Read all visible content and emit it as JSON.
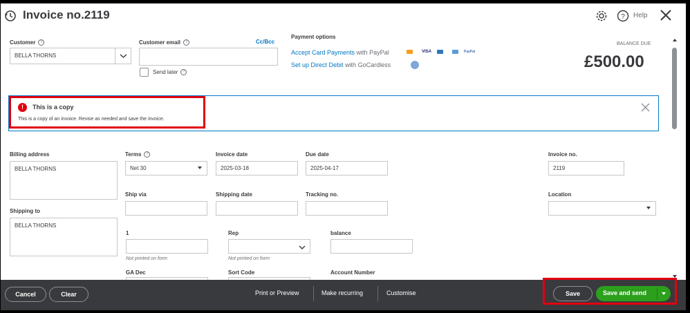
{
  "header": {
    "title": "Invoice no.2119",
    "help_label": "Help"
  },
  "customer": {
    "label": "Customer",
    "value": "BELLA THORNS",
    "email_label": "Customer email",
    "email_value": "",
    "ccbcc_label": "Cc/Bcc",
    "send_later_label": "Send later"
  },
  "payment": {
    "label": "Payment options",
    "card_link": "Accept Card Payments",
    "card_suffix": "with PayPal",
    "debit_link": "Set up Direct Debit",
    "debit_suffix": "with GoCardless",
    "card_brands": [
      "VISA",
      "PayPal"
    ]
  },
  "balance": {
    "label": "BALANCE DUE",
    "amount": "£500.00"
  },
  "alert": {
    "title": "This is a copy",
    "message": "This is a copy of an invoice. Revise as needed and save the invoice."
  },
  "billing": {
    "label": "Billing address",
    "value": "BELLA THORNS",
    "shipping_label": "Shipping to",
    "shipping_value": "BELLA THORNS"
  },
  "terms": {
    "label": "Terms",
    "value": "Net 30"
  },
  "invoice_date": {
    "label": "Invoice date",
    "value": "2025-03-18"
  },
  "due_date": {
    "label": "Due date",
    "value": "2025-04-17"
  },
  "invoice_no": {
    "label": "Invoice no.",
    "value": "2119"
  },
  "ship_via": {
    "label": "Ship via",
    "value": ""
  },
  "shipping_date": {
    "label": "Shipping date",
    "value": ""
  },
  "tracking_no": {
    "label": "Tracking no.",
    "value": ""
  },
  "location": {
    "label": "Location",
    "value": ""
  },
  "custom1": {
    "label": "1",
    "value": "",
    "note": "Not printed on form"
  },
  "rep": {
    "label": "Rep",
    "value": "",
    "note": "Not printed on form"
  },
  "balance_field": {
    "label": "balance",
    "value": ""
  },
  "ga_dec": {
    "label": "GA Dec"
  },
  "sort_code": {
    "label": "Sort Code"
  },
  "account_number": {
    "label": "Account Number"
  },
  "footer": {
    "cancel": "Cancel",
    "clear": "Clear",
    "print_preview": "Print or Preview",
    "make_recurring": "Make recurring",
    "customise": "Customise",
    "save": "Save",
    "save_and_send": "Save and send"
  },
  "colors": {
    "accent_green": "#2ca01c",
    "link_blue": "#0077c5",
    "alert_red": "#e3000f",
    "footer_bg": "#393a3d"
  }
}
